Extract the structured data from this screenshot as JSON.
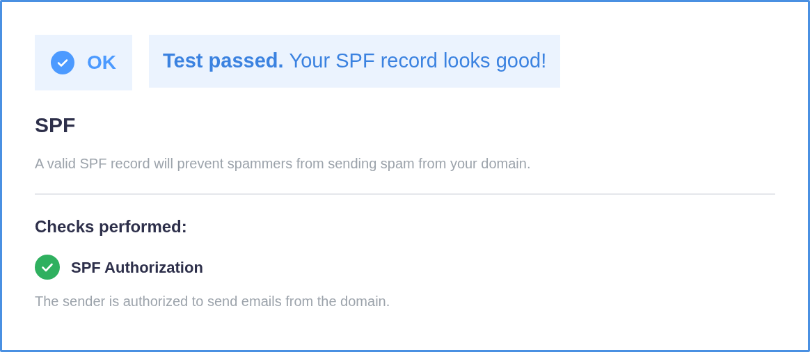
{
  "result": {
    "passed": true,
    "badge": "OK",
    "headline": "Test passed.",
    "message": "Your SPF record looks good!"
  },
  "title": "SPF",
  "description": "A valid SPF record will prevent spammers from sending spam from your domain.",
  "checks_heading": "Checks performed:",
  "checks": [
    {
      "name": "SPF Authorization",
      "passed": true,
      "detail": "The sender is authorized to send emails from the domain."
    }
  ]
}
